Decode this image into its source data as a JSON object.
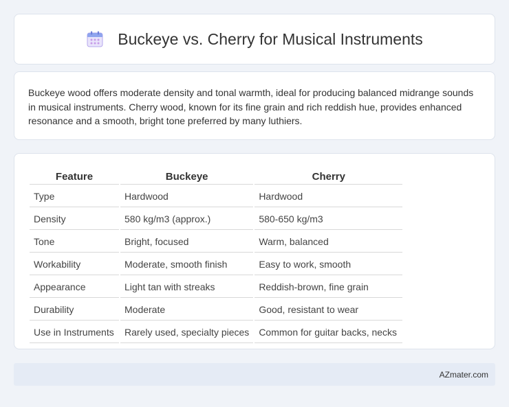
{
  "header": {
    "title": "Buckeye vs. Cherry for Musical Instruments",
    "icon": "calendar-icon"
  },
  "description": "Buckeye wood offers moderate density and tonal warmth, ideal for producing balanced midrange sounds in musical instruments. Cherry wood, known for its fine grain and rich reddish hue, provides enhanced resonance and a smooth, bright tone preferred by many luthiers.",
  "table": {
    "headers": [
      "Feature",
      "Buckeye",
      "Cherry"
    ],
    "rows": [
      [
        "Type",
        "Hardwood",
        "Hardwood"
      ],
      [
        "Density",
        "580 kg/m3 (approx.)",
        "580-650 kg/m3"
      ],
      [
        "Tone",
        "Bright, focused",
        "Warm, balanced"
      ],
      [
        "Workability",
        "Moderate, smooth finish",
        "Easy to work, smooth"
      ],
      [
        "Appearance",
        "Light tan with streaks",
        "Reddish-brown, fine grain"
      ],
      [
        "Durability",
        "Moderate",
        "Good, resistant to wear"
      ],
      [
        "Use in Instruments",
        "Rarely used, specialty pieces",
        "Common for guitar backs, necks"
      ]
    ]
  },
  "footer": {
    "text": "AZmater.com"
  }
}
